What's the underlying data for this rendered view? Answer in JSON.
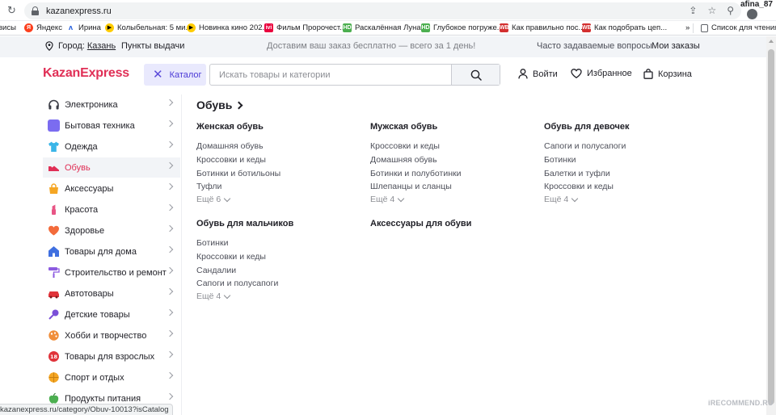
{
  "browser": {
    "url": "kazanexpress.ru",
    "profile_name": "afina_87"
  },
  "bookmarks": {
    "items": [
      {
        "label": "висы",
        "icon": "none"
      },
      {
        "label": "Яндекс",
        "icon": "yandex-icon"
      },
      {
        "label": "Ирина",
        "icon": "bookmark-icon"
      },
      {
        "label": "Колыбельная: 5 ми...",
        "icon": "play-icon"
      },
      {
        "label": "Новинка кино 202...",
        "icon": "play-icon"
      },
      {
        "label": "Фильм Пророчест...",
        "icon": "ivi-icon"
      },
      {
        "label": "Раскалённая Луна...",
        "icon": "hd-icon"
      },
      {
        "label": "Глубокое погруже...",
        "icon": "hd-icon"
      },
      {
        "label": "Как правильно пос...",
        "icon": "wb-icon"
      },
      {
        "label": "Как подобрать цеп...",
        "icon": "wb-icon"
      }
    ],
    "overflow": "»",
    "reading_list": "Список для чтения"
  },
  "site_strip": {
    "city_label": "Город:",
    "city": "Казань",
    "pickup_points": "Пункты выдачи",
    "promo": "Доставим ваш заказ бесплатно — всего за 1 день!",
    "faq": "Часто задаваемые вопросы",
    "my_orders": "Мои заказы"
  },
  "header": {
    "logo": "KazanExpress",
    "catalog_label": "Каталог",
    "search_placeholder": "Искать товары и категории",
    "login": "Войти",
    "favorites": "Избранное",
    "cart": "Корзина"
  },
  "sidebar": {
    "items": [
      {
        "label": "Электроника",
        "icon": "headphones-icon",
        "color": "#3b3d46"
      },
      {
        "label": "Бытовая техника",
        "icon": "appliance-icon",
        "color": "#7b6cf0"
      },
      {
        "label": "Одежда",
        "icon": "tshirt-icon",
        "color": "#3ab5e8"
      },
      {
        "label": "Обувь",
        "icon": "shoe-icon",
        "color": "#e02f56",
        "active": true
      },
      {
        "label": "Аксессуары",
        "icon": "bag-icon",
        "color": "#f5a623"
      },
      {
        "label": "Красота",
        "icon": "lipstick-icon",
        "color": "#e85585"
      },
      {
        "label": "Здоровье",
        "icon": "heart-icon",
        "color": "#f36b3b"
      },
      {
        "label": "Товары для дома",
        "icon": "home-icon",
        "color": "#3f6fe0"
      },
      {
        "label": "Строительство и ремонт",
        "icon": "roller-icon",
        "color": "#8c5be0"
      },
      {
        "label": "Автотовары",
        "icon": "car-icon",
        "color": "#e0333a"
      },
      {
        "label": "Детские товары",
        "icon": "rattle-icon",
        "color": "#7a4fd8"
      },
      {
        "label": "Хобби и творчество",
        "icon": "palette-icon",
        "color": "#f08d3a"
      },
      {
        "label": "Товары для взрослых",
        "icon": "adult-18-icon",
        "color": "#e0333a"
      },
      {
        "label": "Спорт и отдых",
        "icon": "ball-icon",
        "color": "#f5a623"
      },
      {
        "label": "Продукты питания",
        "icon": "apple-icon",
        "color": "#4caf50"
      }
    ]
  },
  "main": {
    "title": "Обувь",
    "columns": [
      {
        "title": "Женская обувь",
        "links": [
          "Домашняя обувь",
          "Кроссовки и кеды",
          "Ботинки и ботильоны",
          "Туфли"
        ],
        "more": "Ещё 6"
      },
      {
        "title": "Мужская обувь",
        "links": [
          "Кроссовки и кеды",
          "Домашняя обувь",
          "Ботинки и полуботинки",
          "Шлепанцы и сланцы"
        ],
        "more": "Ещё 4"
      },
      {
        "title": "Обувь для девочек",
        "links": [
          "Сапоги и полусапоги",
          "Ботинки",
          "Балетки и туфли",
          "Кроссовки и кеды"
        ],
        "more": "Ещё 4"
      },
      {
        "title": "Обувь для мальчиков",
        "links": [
          "Ботинки",
          "Кроссовки и кеды",
          "Сандалии",
          "Сапоги и полусапоги"
        ],
        "more": "Ещё 4"
      },
      {
        "title": "Аксессуары для обуви",
        "links": [],
        "more": ""
      }
    ]
  },
  "status_bar": {
    "text": "kazanexpress.ru/category/Obuv-10013?isCatalog"
  },
  "watermark": "iRECOMMEND.RU"
}
